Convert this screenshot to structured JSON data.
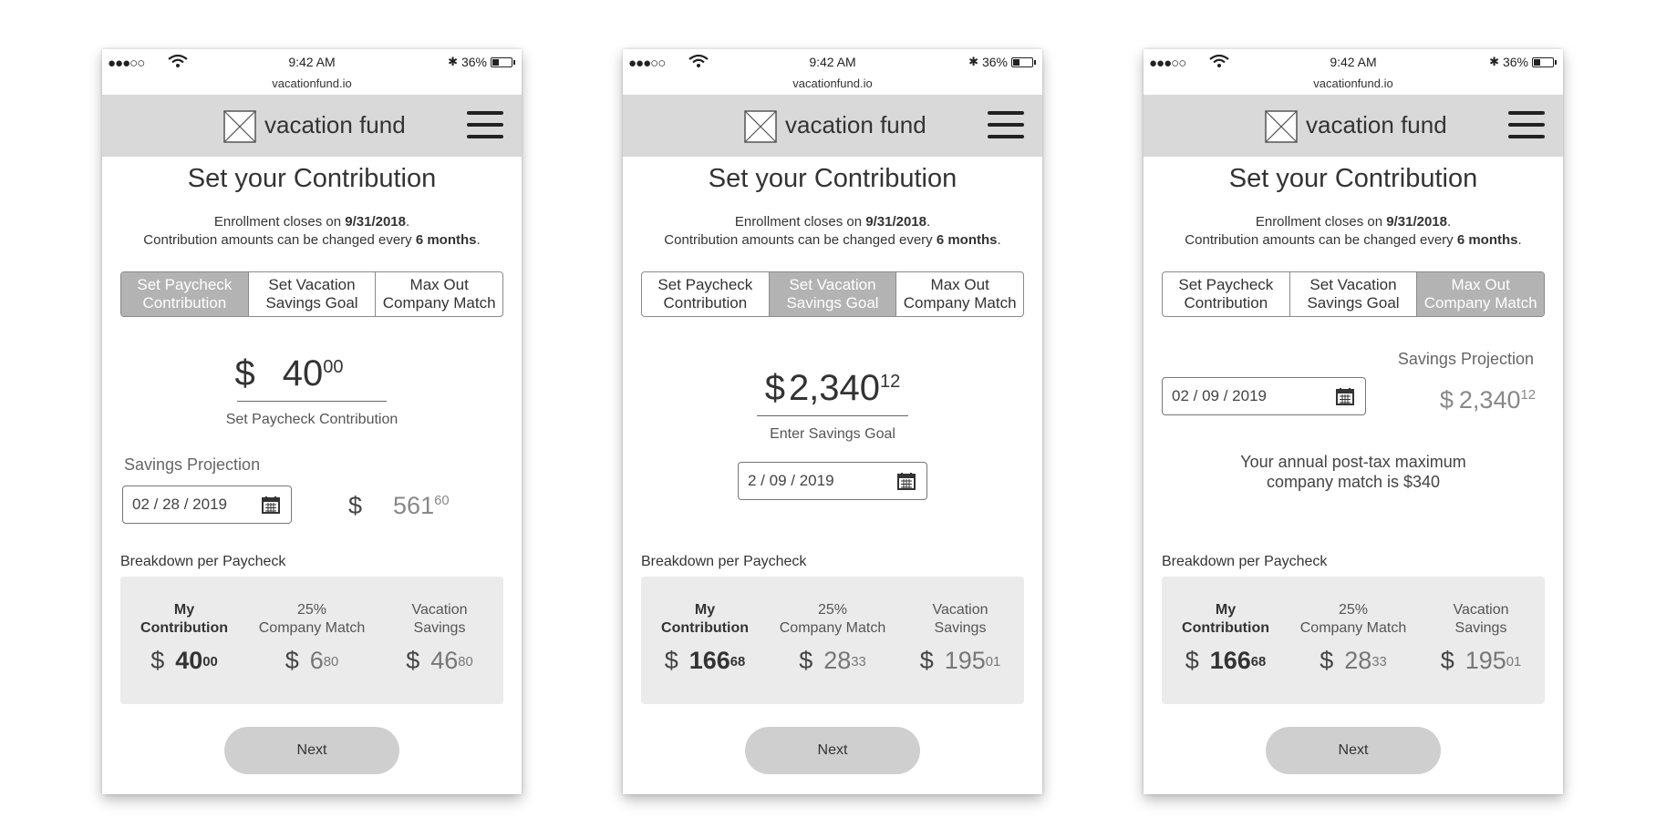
{
  "status": {
    "time": "9:42 AM",
    "url": "vacationfund.io",
    "battery": "36%",
    "signal": "●●●○○"
  },
  "header": {
    "brand": "vacation fund"
  },
  "page": {
    "title": "Set your Contribution",
    "notice_prefix": "Enrollment closes on ",
    "notice_date": "9/31/2018",
    "notice_mid": "Contribution amounts can be changed every ",
    "notice_months": "6 months"
  },
  "tabs": [
    {
      "line1": "Set Paycheck",
      "line2": "Contribution"
    },
    {
      "line1": "Set Vacation",
      "line2": "Savings Goal"
    },
    {
      "line1": "Max Out",
      "line2": "Company Match"
    }
  ],
  "breakdown": {
    "label": "Breakdown per Paycheck",
    "col1_header_line1": "My",
    "col1_header_line2": "Contribution",
    "col2_header_line1": "25%",
    "col2_header_line2": "Company Match",
    "col3_header_line1": "Vacation",
    "col3_header_line2": "Savings"
  },
  "next_label": "Next",
  "screens": [
    {
      "active_tab": 0,
      "amount_currency": "$",
      "amount_main": "40",
      "amount_cents": "00",
      "amount_caption": "Set Paycheck Contribution",
      "projection_label": "Savings Projection",
      "date": "02 / 28 / 2019",
      "projection_currency": "$",
      "projection_main": "561",
      "projection_cents": "60",
      "values": [
        {
          "cur": "$",
          "main": "40",
          "cents": "00"
        },
        {
          "cur": "$",
          "main": "6",
          "cents": "80"
        },
        {
          "cur": "$",
          "main": "46",
          "cents": "80"
        }
      ]
    },
    {
      "active_tab": 1,
      "amount_currency": "$",
      "amount_main": "2,340",
      "amount_cents": "12",
      "amount_caption": "Enter Savings Goal",
      "date": "2 / 09 / 2019",
      "values": [
        {
          "cur": "$",
          "main": "166",
          "cents": "68"
        },
        {
          "cur": "$",
          "main": "28",
          "cents": "33"
        },
        {
          "cur": "$",
          "main": "195",
          "cents": "01"
        }
      ]
    },
    {
      "active_tab": 2,
      "projection_label": "Savings Projection",
      "date": "02 / 09 / 2019",
      "projection_currency": "$",
      "projection_main": "2,340",
      "projection_cents": "12",
      "note_line1": "Your annual post-tax maximum",
      "note_line2": "company match is $340",
      "values": [
        {
          "cur": "$",
          "main": "166",
          "cents": "68"
        },
        {
          "cur": "$",
          "main": "28",
          "cents": "33"
        },
        {
          "cur": "$",
          "main": "195",
          "cents": "01"
        }
      ]
    }
  ],
  "icons": {
    "logo": "image-placeholder-icon",
    "menu": "hamburger-menu-icon",
    "calendar": "calendar-icon",
    "wifi": "wifi-icon",
    "bluetooth": "bluetooth-icon",
    "battery": "battery-icon"
  },
  "colors": {
    "header_bg": "#d9d9d9",
    "active_tab_bg": "#b3b3b3",
    "breakdown_bg": "#ebebeb",
    "next_bg": "#cfcfcf"
  }
}
